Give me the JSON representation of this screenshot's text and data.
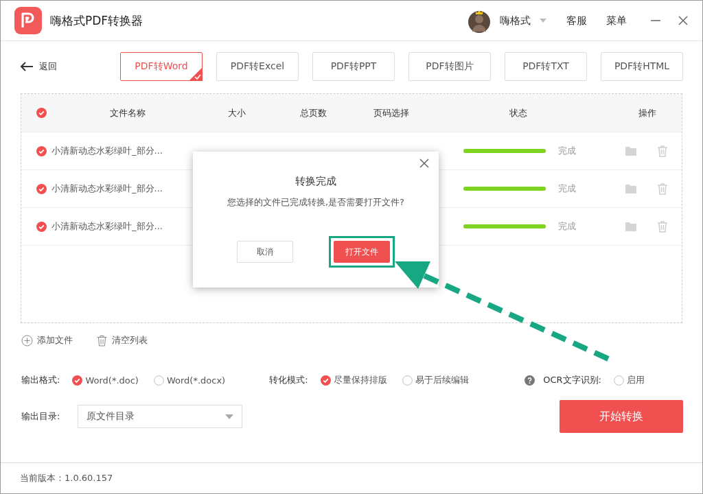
{
  "window": {
    "title": "嗨格式PDF转换器",
    "user": "嗨格式",
    "service": "客服",
    "menu": "菜单"
  },
  "back": "返回",
  "tabs": [
    {
      "label": "PDF转Word",
      "selected": true
    },
    {
      "label": "PDF转Excel",
      "selected": false
    },
    {
      "label": "PDF转PPT",
      "selected": false
    },
    {
      "label": "PDF转图片",
      "selected": false
    },
    {
      "label": "PDF转TXT",
      "selected": false
    },
    {
      "label": "PDF转HTML",
      "selected": false
    }
  ],
  "table": {
    "all_checked": true,
    "columns": [
      "文件名称",
      "大小",
      "总页数",
      "页码选择",
      "状态",
      "操作"
    ],
    "rows": [
      {
        "checked": true,
        "name": "小清新动态水彩绿叶_部分...",
        "level": 1,
        "status": "完成"
      },
      {
        "checked": true,
        "name": "小清新动态水彩绿叶_部分...",
        "level": 1,
        "status": "完成"
      },
      {
        "checked": true,
        "name": "小清新动态水彩绿叶_部分...",
        "level": 1,
        "status": "完成"
      }
    ]
  },
  "list_actions": [
    "添加文件",
    "清空列表"
  ],
  "output_format": {
    "label": "输出格式:",
    "options": [
      {
        "label": "Word(*.doc)",
        "selected": true
      },
      {
        "label": "Word(*.docx)",
        "selected": false
      }
    ]
  },
  "conversion_mode": {
    "label": "转化模式:",
    "options": [
      {
        "label": "尽量保持排版",
        "selected": true
      },
      {
        "label": "易于后续编辑",
        "selected": false
      }
    ]
  },
  "ocr": {
    "label": "OCR文字识别:",
    "options": [
      {
        "label": "启用",
        "selected": false
      }
    ]
  },
  "output_dir": {
    "label": "输出目录:",
    "value": "原文件目录"
  },
  "start_button": "开始转换",
  "version": "当前版本：1.0.60.157",
  "dialog": {
    "title": "转换完成",
    "message": "您选择的文件已完成转换,是否需要打开文件?",
    "buttons": [
      {
        "label": "取消",
        "kind": "secondary",
        "highlighted": false
      },
      {
        "label": "打开文件",
        "kind": "primary",
        "highlighted": true
      }
    ]
  }
}
